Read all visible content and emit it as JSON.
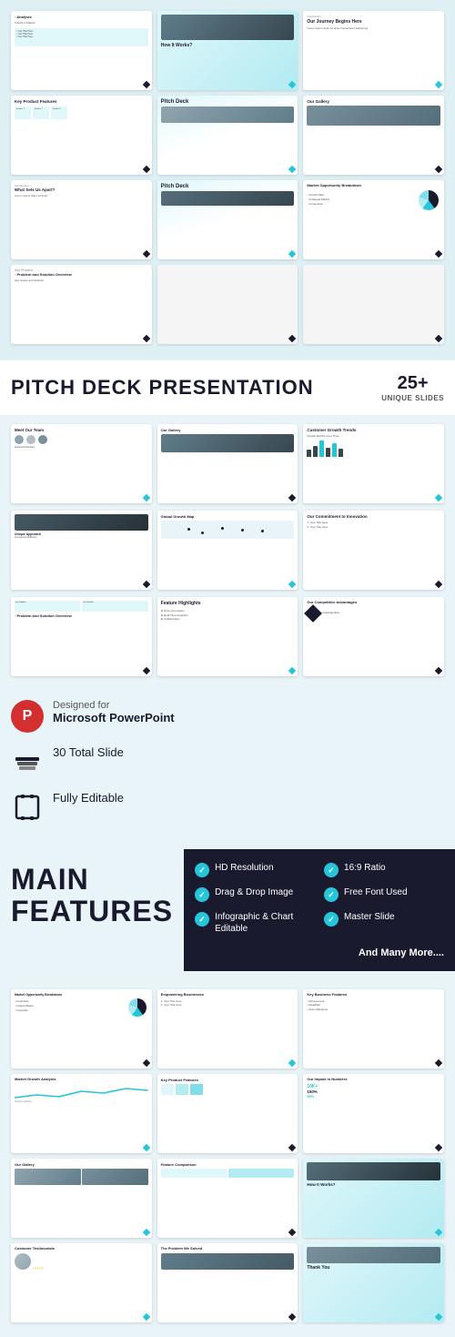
{
  "product": {
    "title": "PITCH DECK PRESENTATION",
    "slides_count": "25+",
    "slides_label": "UNIQUE SLIDES"
  },
  "features": {
    "designed_for": "Designed for",
    "powerpoint": "Microsoft PowerPoint",
    "total_slides": "30 Total Slide",
    "editable": "Fully Editable"
  },
  "main_features": {
    "heading_line1": "MAIN",
    "heading_line2": "FEATURES",
    "items": [
      {
        "label": "HD Resolution"
      },
      {
        "label": "16:9 Ratio"
      },
      {
        "label": "Drag & Drop Image"
      },
      {
        "label": "Free Font Used"
      },
      {
        "label": "Infographic & Chart Editable"
      },
      {
        "label": "Master Slide"
      }
    ],
    "and_more": "And Many More...."
  },
  "slides": {
    "row1": [
      {
        "title": "Analysis",
        "desc": "Trends in Market"
      },
      {
        "title": "How It Works?",
        "has_img": true
      },
      {
        "title": "Our Journey Begins Here",
        "desc": "Introduction"
      }
    ],
    "row2": [
      {
        "title": "Key Product Features"
      },
      {
        "title": "Pitch Deck",
        "has_img": true
      },
      {
        "title": "Our Gallery",
        "has_img": true
      }
    ],
    "row3": [
      {
        "title": "What Sets Us Apart?"
      },
      {
        "title": "Pitch Deck",
        "has_img": true
      },
      {
        "title": "Market Opportunity Breakdown"
      }
    ],
    "row4": [
      {
        "title": "Problem and Solution Overview"
      },
      {
        "title": "",
        "blank": true
      },
      {
        "title": "",
        "blank": true
      }
    ],
    "mid_row1": [
      {
        "title": "Meet Our Team",
        "has_avatars": true
      },
      {
        "title": "Our Gallery",
        "has_img": true
      },
      {
        "title": "Customer Growth Trends",
        "has_chart": true
      }
    ],
    "mid_row2": [
      {
        "title": "Unique Approach"
      },
      {
        "title": "Global Growth Map"
      },
      {
        "title": "Our Commitment to Innovation"
      }
    ],
    "mid_row3": [
      {
        "title": "Problem and Solution Overview"
      },
      {
        "title": "Feature Highlights"
      },
      {
        "title": "Our Competitive Advantages"
      }
    ],
    "bottom_row1": [
      {
        "title": "Market Opportunity Breakdown"
      },
      {
        "title": "Empowering Businesses"
      },
      {
        "title": "Key Business Features"
      }
    ],
    "bottom_row2": [
      {
        "title": "Market Growth Analysis"
      },
      {
        "title": "Key Product Features"
      },
      {
        "title": "Our Impact in Numbers"
      }
    ],
    "bottom_row3": [
      {
        "title": "Our Gallery",
        "has_img": true
      },
      {
        "title": "Feature Comparison"
      },
      {
        "title": "How It Works?",
        "has_img": true
      }
    ],
    "bottom_row4": [
      {
        "title": "Customer Testimonials"
      },
      {
        "title": "The Problem We Solved"
      },
      {
        "title": "Thank You",
        "has_img": true
      }
    ]
  }
}
